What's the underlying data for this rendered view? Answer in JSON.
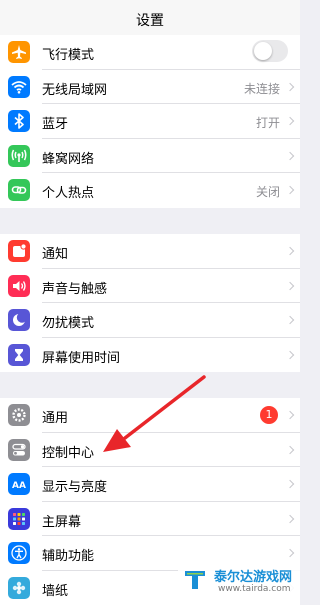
{
  "header": {
    "title": "设置"
  },
  "groups": [
    {
      "items": [
        {
          "label": "飞行模式",
          "icon": "airplane-icon",
          "color": "#ff9500",
          "toggle": false
        },
        {
          "label": "无线局域网",
          "icon": "wifi-icon",
          "color": "#007aff",
          "value": "未连接"
        },
        {
          "label": "蓝牙",
          "icon": "bluetooth-icon",
          "color": "#007aff",
          "value": "打开"
        },
        {
          "label": "蜂窝网络",
          "icon": "cellular-icon",
          "color": "#34c759"
        },
        {
          "label": "个人热点",
          "icon": "hotspot-icon",
          "color": "#34c759",
          "value": "关闭"
        }
      ]
    },
    {
      "items": [
        {
          "label": "通知",
          "icon": "notifications-icon",
          "color": "#ff3b30"
        },
        {
          "label": "声音与触感",
          "icon": "sound-icon",
          "color": "#ff2d55"
        },
        {
          "label": "勿扰模式",
          "icon": "moon-icon",
          "color": "#5856d6"
        },
        {
          "label": "屏幕使用时间",
          "icon": "hourglass-icon",
          "color": "#5856d6"
        }
      ]
    },
    {
      "items": [
        {
          "label": "通用",
          "icon": "gear-icon",
          "color": "#8e8e93",
          "badge": "1"
        },
        {
          "label": "控制中心",
          "icon": "control-center-icon",
          "color": "#8e8e93"
        },
        {
          "label": "显示与亮度",
          "icon": "display-icon",
          "color": "#007aff"
        },
        {
          "label": "主屏幕",
          "icon": "home-screen-icon",
          "color": "#3a3adb"
        },
        {
          "label": "辅助功能",
          "icon": "accessibility-icon",
          "color": "#007aff"
        },
        {
          "label": "墙纸",
          "icon": "wallpaper-icon",
          "color": "#34aadc"
        }
      ]
    }
  ],
  "annotation": {
    "color": "#e8262a"
  },
  "watermark": {
    "name": "泰尔达游戏网",
    "url": "www.tairda.com"
  }
}
